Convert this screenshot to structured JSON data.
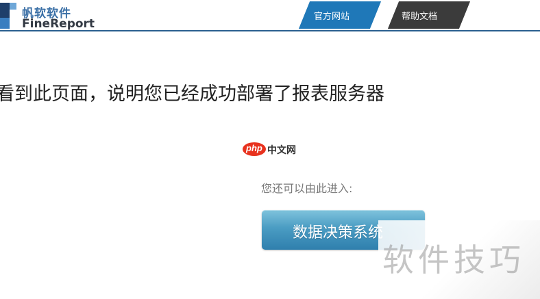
{
  "header": {
    "logo": {
      "cn": "帆软软件",
      "en": "FineReport"
    },
    "nav": {
      "official_site": "官方网站",
      "help_docs": "帮助文档"
    },
    "colors": {
      "official_tab": "#1f78b8",
      "help_tab": "#3b3b3b",
      "brand": "#3a6fa6"
    }
  },
  "main": {
    "message": "看到此页面，说明您已经成功部署了报表服务器",
    "php_badge": {
      "logo_text": "php",
      "site_text": "中文网"
    },
    "enter_prompt": "您还可以由此进入:",
    "decision_button_label": "数据决策系统"
  },
  "watermark": {
    "text": "软件技巧"
  }
}
